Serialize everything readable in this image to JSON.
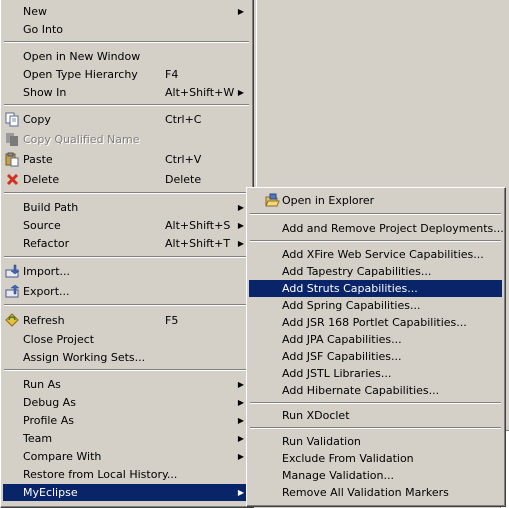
{
  "context_menu": {
    "items": [
      {
        "label": "New",
        "arrow": "▶"
      },
      {
        "label": "Go Into"
      },
      {
        "label": "Open in New Window"
      },
      {
        "label": "Open Type Hierarchy",
        "accel": "F4"
      },
      {
        "label": "Show In",
        "accel": "Alt+Shift+W",
        "arrow": "▶"
      },
      {
        "label": "Copy",
        "accel": "Ctrl+C",
        "icon": "copy-icon"
      },
      {
        "label": "Copy Qualified Name",
        "icon": "copy-qualified-name-icon",
        "disabled": true
      },
      {
        "label": "Paste",
        "accel": "Ctrl+V",
        "icon": "paste-icon"
      },
      {
        "label": "Delete",
        "accel": "Delete",
        "icon": "delete-icon"
      },
      {
        "label": "Build Path",
        "arrow": "▶"
      },
      {
        "label": "Source",
        "accel": "Alt+Shift+S",
        "arrow": "▶"
      },
      {
        "label": "Refactor",
        "accel": "Alt+Shift+T",
        "arrow": "▶"
      },
      {
        "label": "Import...",
        "icon": "import-icon"
      },
      {
        "label": "Export...",
        "icon": "export-icon"
      },
      {
        "label": "Refresh",
        "accel": "F5",
        "icon": "refresh-icon"
      },
      {
        "label": "Close Project"
      },
      {
        "label": "Assign Working Sets..."
      },
      {
        "label": "Run As",
        "arrow": "▶"
      },
      {
        "label": "Debug As",
        "arrow": "▶"
      },
      {
        "label": "Profile As",
        "arrow": "▶"
      },
      {
        "label": "Team",
        "arrow": "▶"
      },
      {
        "label": "Compare With",
        "arrow": "▶"
      },
      {
        "label": "Restore from Local History..."
      },
      {
        "label": "MyEclipse",
        "arrow": "▶",
        "selected": true
      }
    ]
  },
  "myeclipse_submenu": {
    "items": [
      {
        "label": "Open in Explorer",
        "icon": "folder-open-icon"
      },
      {
        "label": "Add and Remove Project Deployments..."
      },
      {
        "label": "Add XFire Web Service Capabilities..."
      },
      {
        "label": "Add Tapestry Capabilities..."
      },
      {
        "label": "Add Struts Capabilities...",
        "selected": true
      },
      {
        "label": "Add Spring Capabilities..."
      },
      {
        "label": "Add JSR 168 Portlet Capabilities..."
      },
      {
        "label": "Add JPA Capabilities..."
      },
      {
        "label": "Add JSF Capabilities..."
      },
      {
        "label": "Add JSTL Libraries..."
      },
      {
        "label": "Add Hibernate Capabilities..."
      },
      {
        "label": "Run XDoclet"
      },
      {
        "label": "Run Validation"
      },
      {
        "label": "Exclude From Validation"
      },
      {
        "label": "Manage Validation..."
      },
      {
        "label": "Remove All Validation Markers"
      }
    ]
  },
  "colors": {
    "menu_bg": "#d4d0c8",
    "selection_bg": "#0a246a",
    "selection_fg": "#ffffff",
    "disabled_fg": "#808080"
  }
}
